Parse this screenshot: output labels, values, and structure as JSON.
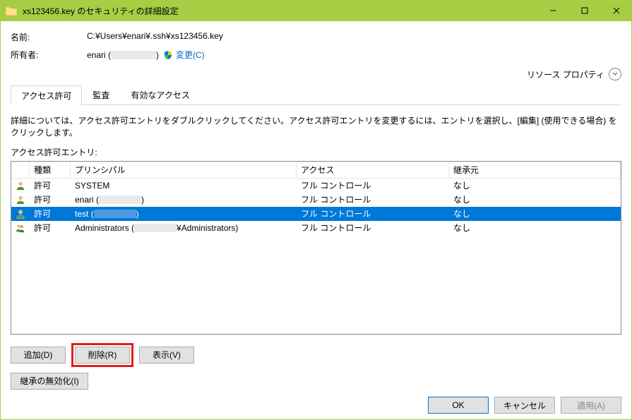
{
  "window": {
    "title": "xs123456.key のセキュリティの詳細設定"
  },
  "header": {
    "name_label": "名前:",
    "name_value": "C:¥Users¥enari¥.ssh¥xs123456.key",
    "owner_label": "所有者:",
    "owner_value": "enari (",
    "owner_suffix": ")",
    "change_link": "変更(C)",
    "resource_prop": "リソース プロパティ"
  },
  "tabs": [
    {
      "label": "アクセス許可",
      "active": true
    },
    {
      "label": "監査",
      "active": false
    },
    {
      "label": "有効なアクセス",
      "active": false
    }
  ],
  "description": "詳細については、アクセス許可エントリをダブルクリックしてください。アクセス許可エントリを変更するには、エントリを選択し、[編集] (使用できる場合) をクリックします。",
  "entries_label": "アクセス許可エントリ:",
  "columns": {
    "type": "種類",
    "principal": "プリンシパル",
    "access": "アクセス",
    "inherit": "継承元"
  },
  "rows": [
    {
      "icon": "user",
      "type": "許可",
      "principal": "SYSTEM",
      "access": "フル コントロール",
      "inherit": "なし",
      "selected": false
    },
    {
      "icon": "user",
      "type": "許可",
      "principal_prefix": "enari (",
      "principal_suffix": ")",
      "redacted": true,
      "access": "フル コントロール",
      "inherit": "なし",
      "selected": false
    },
    {
      "icon": "user",
      "type": "許可",
      "principal_prefix": "test (",
      "principal_suffix": ")",
      "redacted": true,
      "access": "フル コントロール",
      "inherit": "なし",
      "selected": true
    },
    {
      "icon": "group",
      "type": "許可",
      "principal_prefix": "Administrators (",
      "principal_mid": "¥Administrators",
      "principal_suffix": ")",
      "redacted": true,
      "access": "フル コントロール",
      "inherit": "なし",
      "selected": false
    }
  ],
  "buttons": {
    "add": "追加(D)",
    "remove": "削除(R)",
    "view": "表示(V)",
    "disable_inherit": "継承の無効化(I)",
    "ok": "OK",
    "cancel": "キャンセル",
    "apply": "適用(A)"
  }
}
